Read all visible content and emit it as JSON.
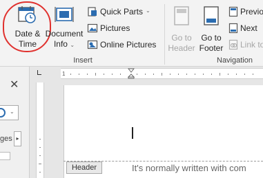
{
  "ribbon": {
    "date_time": [
      "Date &",
      "Time"
    ],
    "document_info": [
      "Document",
      "Info"
    ],
    "document_info_caret": "⌄",
    "quick_parts": "Quick Parts",
    "quick_parts_caret": "⌄",
    "pictures": "Pictures",
    "online_pictures": "Online Pictures",
    "insert_group": "Insert",
    "go_to_header": [
      "Go to",
      "Header"
    ],
    "go_to_footer": [
      "Go to",
      "Footer"
    ],
    "previous": "Previo",
    "next": "Next",
    "link_to": "Link to",
    "navigation_group": "Navigation"
  },
  "left_pane": {
    "close": "✕",
    "pages_tab": "ges",
    "dropdown_caret": "⌄"
  },
  "document": {
    "header_tab": "Header",
    "hint_text": "It's normally written with com"
  },
  "colors": {
    "highlight": "#e0312e",
    "accent_blue": "#2b6cb0"
  }
}
